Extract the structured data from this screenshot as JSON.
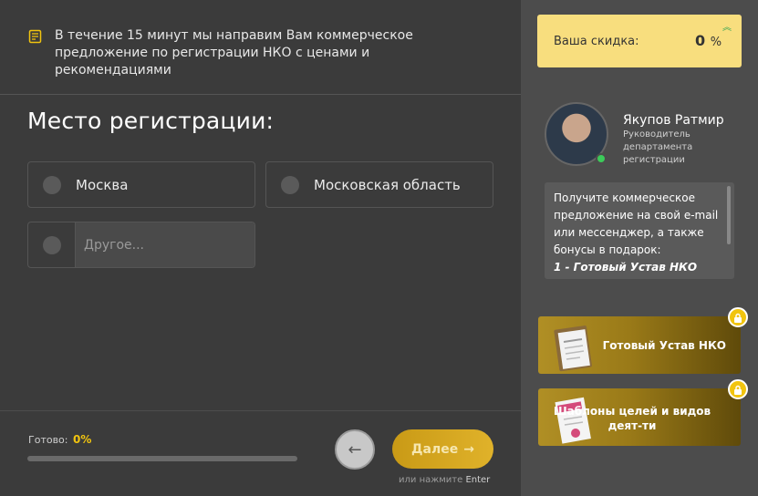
{
  "notice": {
    "icon": "checklist-icon",
    "text": "В течение 15 минут мы направим Вам коммерческое предложение по регистрации НКО с ценами и рекомендациями"
  },
  "question": {
    "title": "Место регистрации:",
    "options": [
      {
        "label": "Москва"
      },
      {
        "label": "Московская область"
      }
    ],
    "other_placeholder": "Другое..."
  },
  "footer": {
    "progress_label": "Готово:",
    "progress_value": "0%",
    "progress_fraction": 0,
    "next_label": "Далее",
    "hint_prefix": "или нажмите",
    "hint_key": "Enter"
  },
  "sidebar": {
    "discount_label": "Ваша скидка:",
    "discount_value": "0",
    "discount_unit": "%",
    "manager": {
      "name": "Якупов Ратмир",
      "role": "Руководитель департамента регистрации"
    },
    "message": "Получите коммерческое предложение на свой e-mail или мессенджер, а также бонусы в подарок:",
    "message_bonus": "1 - Готовый Устав НКО",
    "bonuses": [
      {
        "label": "Готовый Устав НКО"
      },
      {
        "label": "Шаблоны целей и видов деят-ти"
      }
    ]
  },
  "colors": {
    "accent": "#f1c40f",
    "discount_bg": "#f8de7e",
    "online": "#3ccb5a"
  }
}
